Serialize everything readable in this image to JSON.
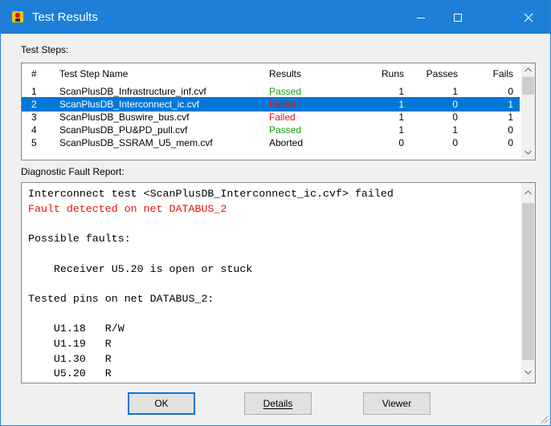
{
  "window": {
    "title": "Test Results"
  },
  "labels": {
    "test_steps": "Test Steps:",
    "diagnostic_report": "Diagnostic Fault Report:"
  },
  "table": {
    "headers": [
      "#",
      "Test Step Name",
      "Results",
      "Runs",
      "Passes",
      "Fails"
    ],
    "rows": [
      {
        "num": "1",
        "name": "ScanPlusDB_Infrastructure_inf.cvf",
        "result": "Passed",
        "runs": "1",
        "passes": "1",
        "fails": "0"
      },
      {
        "num": "2",
        "name": "ScanPlusDB_Interconnect_ic.cvf",
        "result": "Failed",
        "runs": "1",
        "passes": "0",
        "fails": "1"
      },
      {
        "num": "3",
        "name": "ScanPlusDB_Buswire_bus.cvf",
        "result": "Failed",
        "runs": "1",
        "passes": "0",
        "fails": "1"
      },
      {
        "num": "4",
        "name": "ScanPlusDB_PU&PD_pull.cvf",
        "result": "Passed",
        "runs": "1",
        "passes": "1",
        "fails": "0"
      },
      {
        "num": "5",
        "name": "ScanPlusDB_SSRAM_U5_mem.cvf",
        "result": "Aborted",
        "runs": "0",
        "passes": "0",
        "fails": "0"
      }
    ],
    "selected_index": 1
  },
  "report": {
    "lines": [
      {
        "text": "Interconnect test <ScanPlusDB_Interconnect_ic.cvf> failed",
        "color": "#000000"
      },
      {
        "text": "Fault detected on net DATABUS_2",
        "color": "#e81010"
      },
      {
        "text": "",
        "color": "#000000"
      },
      {
        "text": "Possible faults:",
        "color": "#000000"
      },
      {
        "text": "",
        "color": "#000000"
      },
      {
        "text": "    Receiver U5.20 is open or stuck",
        "color": "#000000"
      },
      {
        "text": "",
        "color": "#000000"
      },
      {
        "text": "Tested pins on net DATABUS_2:",
        "color": "#000000"
      },
      {
        "text": "",
        "color": "#000000"
      },
      {
        "text": "    U1.18   R/W",
        "color": "#000000"
      },
      {
        "text": "    U1.19   R",
        "color": "#000000"
      },
      {
        "text": "    U1.30   R",
        "color": "#000000"
      },
      {
        "text": "    U5.20   R",
        "color": "#000000"
      }
    ]
  },
  "buttons": {
    "ok": "OK",
    "details": "Details",
    "viewer": "Viewer"
  },
  "colors": {
    "titlebar": "#1e7fd8",
    "selection": "#0078d7",
    "passed": "#11a011",
    "failed": "#e81010"
  }
}
